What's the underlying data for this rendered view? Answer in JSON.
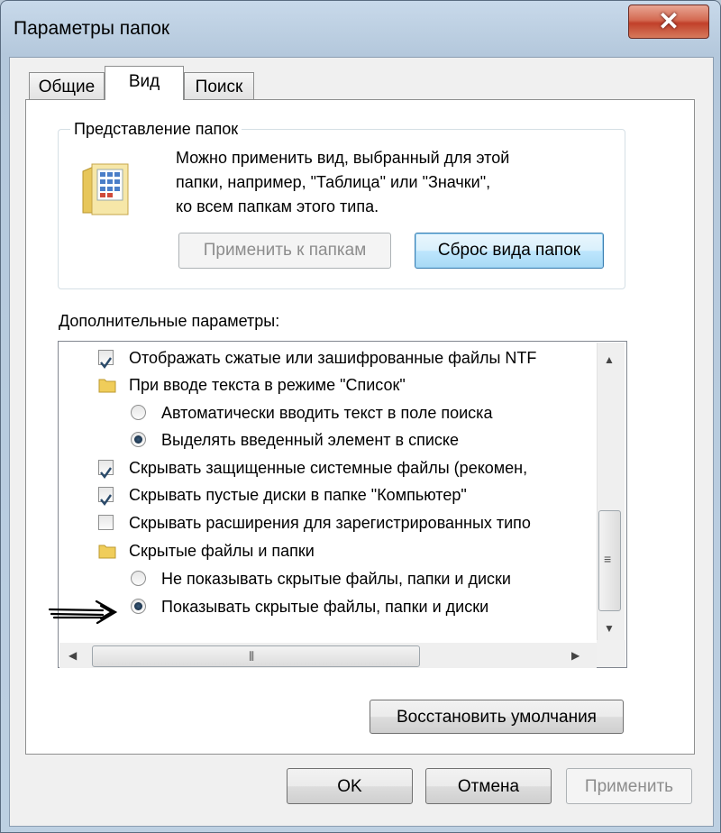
{
  "window": {
    "title": "Параметры папок",
    "close_label": "✕"
  },
  "tabs": [
    {
      "label": "Общие",
      "active": false
    },
    {
      "label": "Вид",
      "active": true
    },
    {
      "label": "Поиск",
      "active": false
    }
  ],
  "folder_views": {
    "legend": "Представление папок",
    "description_lines": [
      "Можно применить вид, выбранный для этой",
      "папки, например, \"Таблица\" или \"Значки\",",
      "ко всем папкам этого типа."
    ],
    "apply_button": "Применить к папкам",
    "reset_button": "Сброс вида папок"
  },
  "advanced": {
    "label": "Дополнительные параметры:",
    "items": [
      {
        "type": "checkbox",
        "checked": true,
        "label": "Отображать сжатые или зашифрованные файлы NTF"
      },
      {
        "type": "folder",
        "label": "При вводе текста в режиме \"Список\""
      },
      {
        "type": "radio",
        "checked": false,
        "label": "Автоматически вводить текст в поле поиска"
      },
      {
        "type": "radio",
        "checked": true,
        "label": "Выделять введенный элемент в списке"
      },
      {
        "type": "checkbox",
        "checked": true,
        "label": "Скрывать защищенные системные файлы (рекомен,"
      },
      {
        "type": "checkbox",
        "checked": true,
        "label": "Скрывать пустые диски в папке \"Компьютер\""
      },
      {
        "type": "checkbox",
        "checked": false,
        "label": "Скрывать расширения для зарегистрированных типо"
      },
      {
        "type": "folder",
        "label": "Скрытые файлы и папки"
      },
      {
        "type": "radio",
        "checked": false,
        "label": "Не показывать скрытые файлы, папки и диски"
      },
      {
        "type": "radio",
        "checked": true,
        "label": "Показывать скрытые файлы, папки и диски"
      }
    ],
    "restore_button": "Восстановить умолчания"
  },
  "footer": {
    "ok": "OK",
    "cancel": "Отмена",
    "apply": "Применить"
  },
  "colors": {
    "accent_border": "#3c7fb1",
    "close_red": "#c1402a",
    "disabled_text": "#8d8d8d"
  }
}
